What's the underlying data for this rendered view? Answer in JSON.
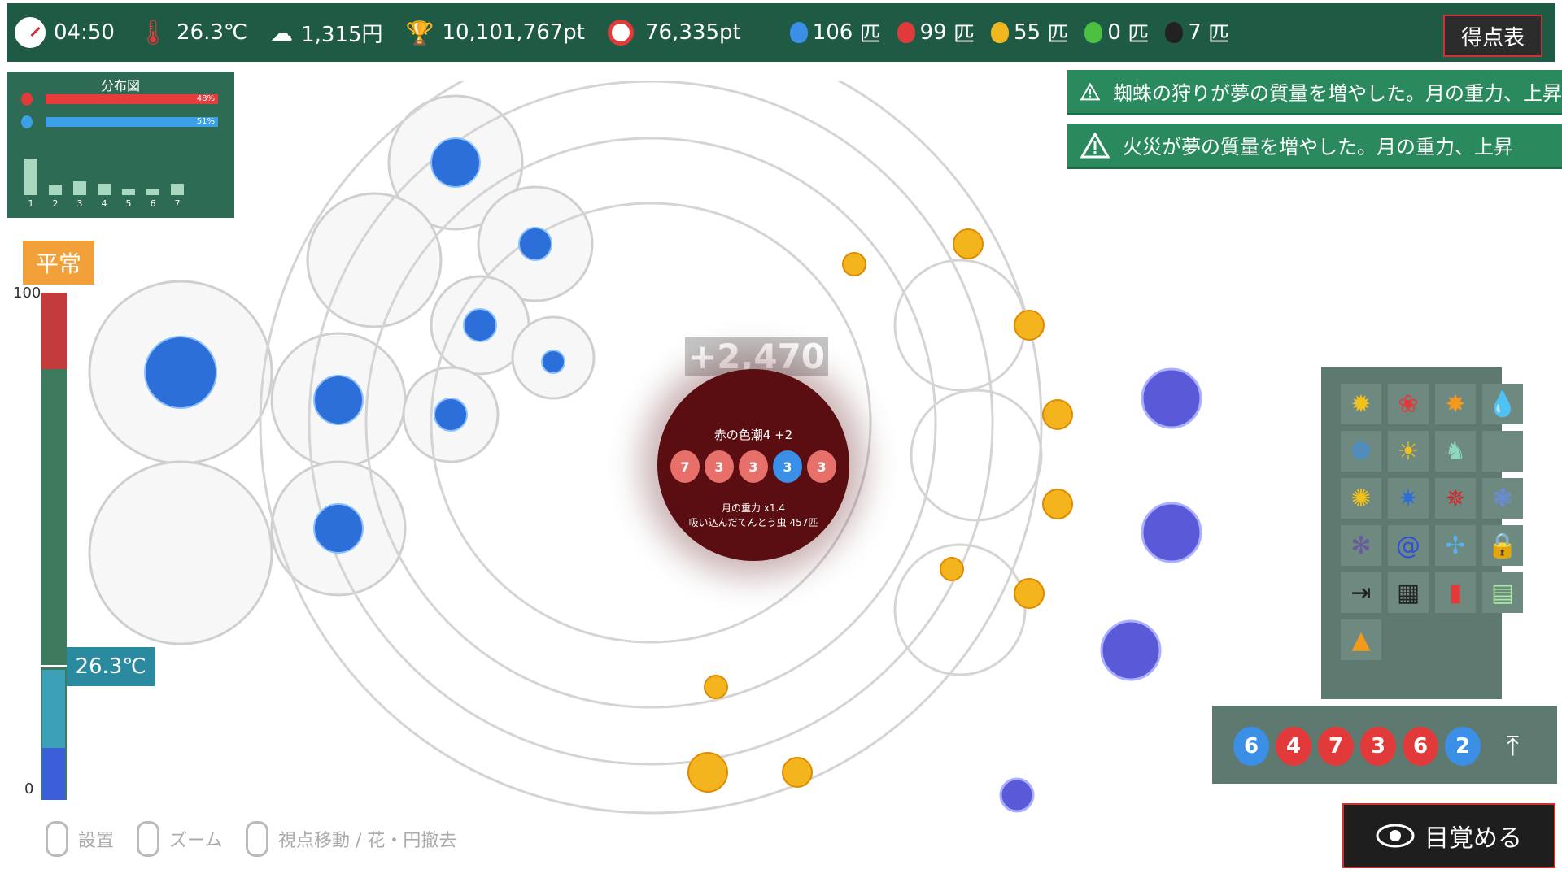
{
  "topbar": {
    "time": "04:50",
    "temperature": "26.3℃",
    "money": "1,315円",
    "trophy_points": "10,101,767pt",
    "target_points": "76,335pt",
    "bugs": [
      {
        "count": "106",
        "unit": "匹",
        "color": "#3c8fe6"
      },
      {
        "count": "99",
        "unit": "匹",
        "color": "#e23a3a"
      },
      {
        "count": "55",
        "unit": "匹",
        "color": "#f0b820"
      },
      {
        "count": "0",
        "unit": "匹",
        "color": "#4cc040"
      },
      {
        "count": "7",
        "unit": "匹",
        "color": "#222222"
      }
    ],
    "score_button": "得点表"
  },
  "distribution": {
    "title": "分布図",
    "red_pct": "48%",
    "blue_pct": "51%",
    "histogram": [
      0.75,
      0.22,
      0.28,
      0.24,
      0.12,
      0.14,
      0.24
    ],
    "histogram_labels": [
      "1",
      "2",
      "3",
      "4",
      "5",
      "6",
      "7"
    ]
  },
  "status": {
    "mode": "平常",
    "gauge_max": "100",
    "gauge_min": "0",
    "gauge_temp": "26.3℃"
  },
  "notifications": [
    "蜘蛛の狩りが夢の質量を増やした。月の重力、上昇",
    "火災が夢の質量を増やした。月の重力、上昇"
  ],
  "center": {
    "gain": "+2,470",
    "title": "赤の色潮4 +2",
    "bugs": [
      {
        "n": "7",
        "color": "#e8706a"
      },
      {
        "n": "3",
        "color": "#e8706a"
      },
      {
        "n": "3",
        "color": "#e8706a"
      },
      {
        "n": "3",
        "color": "#3c8fe6"
      },
      {
        "n": "3",
        "color": "#e8706a"
      }
    ],
    "line1": "月の重力 x1.4",
    "line2": "吸い込んだてんとう虫 457匹"
  },
  "palette_icons": [
    "sunflower-icon",
    "red-rose-icon",
    "orange-flower-icon",
    "water-drop-icon",
    "blue-rose-icon",
    "sun-icon",
    "seahorse-icon",
    "empty-slot",
    "yellow-flower-icon",
    "blue-spiky-icon",
    "red-lily-icon",
    "blue-bellflower-icon",
    "thistle-icon",
    "spiral-icon",
    "pinwheel-icon",
    "lock-icon",
    "exit-icon",
    "net-icon",
    "card-icon",
    "chat-icon",
    "pyramid-eye-icon"
  ],
  "queue": [
    {
      "n": "6",
      "color": "#3c8fe6"
    },
    {
      "n": "4",
      "color": "#e23a3a"
    },
    {
      "n": "7",
      "color": "#e23a3a"
    },
    {
      "n": "3",
      "color": "#e23a3a"
    },
    {
      "n": "6",
      "color": "#e23a3a"
    },
    {
      "n": "2",
      "color": "#3c8fe6"
    }
  ],
  "wake_button": "目覚める",
  "hints": [
    "設置",
    "ズーム",
    "視点移動 / 花・円撤去"
  ]
}
